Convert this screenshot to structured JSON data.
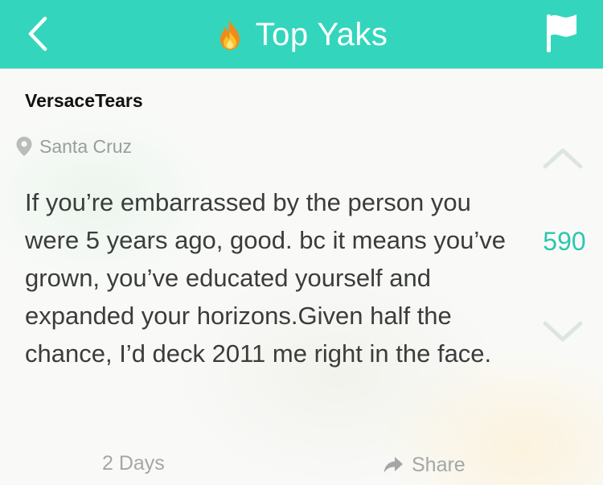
{
  "header": {
    "title": "Top Yaks",
    "back_icon": "chevron-left-icon",
    "title_icon": "fire-icon",
    "flag_icon": "flag-icon",
    "accent_color": "#33d6bc"
  },
  "post": {
    "author": "VersaceTears",
    "location": "Santa Cruz",
    "location_icon": "map-pin-icon",
    "text": "If you’re embarrassed by the person you were 5 years ago, good. bc it means you’ve grown, you’ve educated yourself and expanded your horizons.Given half the chance, I’d deck 2011 me right in the face.",
    "score": "590",
    "upvote_icon": "chevron-up-icon",
    "downvote_icon": "chevron-down-icon",
    "timestamp": "2 Days",
    "share_label": "Share",
    "share_icon": "share-arrow-icon"
  }
}
